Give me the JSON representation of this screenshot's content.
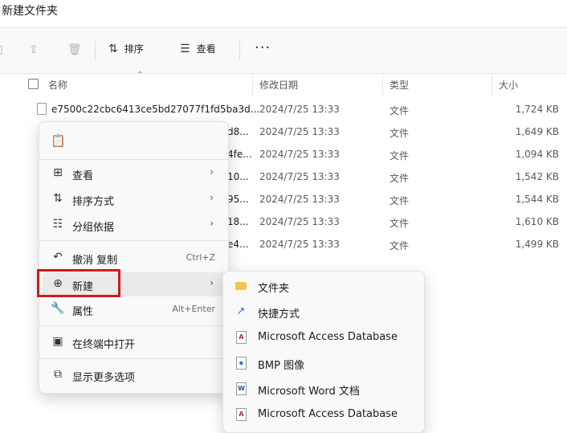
{
  "window": {
    "title": "新建文件夹"
  },
  "toolbar": {
    "sort_label": "排序",
    "view_label": "查看",
    "more_label": "···"
  },
  "columns": {
    "name": "名称",
    "modified": "修改日期",
    "type": "类型",
    "size": "大小"
  },
  "files": [
    {
      "name": "e7500c22cbc6413ce5bd27077f1fd5ba3d...",
      "date": "2024/7/25 13:33",
      "type": "文件",
      "size": "1,724 KB"
    },
    {
      "name": "d8...",
      "date": "2024/7/25 13:33",
      "type": "文件",
      "size": "1,649 KB"
    },
    {
      "name": "4fe...",
      "date": "2024/7/25 13:33",
      "type": "文件",
      "size": "1,094 KB"
    },
    {
      "name": "10...",
      "date": "2024/7/25 13:33",
      "type": "文件",
      "size": "1,542 KB"
    },
    {
      "name": "95...",
      "date": "2024/7/25 13:33",
      "type": "文件",
      "size": "1,544 KB"
    },
    {
      "name": "18...",
      "date": "2024/7/25 13:33",
      "type": "文件",
      "size": "1,610 KB"
    },
    {
      "name": "e4...",
      "date": "2024/7/25 13:33",
      "type": "文件",
      "size": "1,499 KB"
    }
  ],
  "context_menu": {
    "items": [
      {
        "label": "查看",
        "icon": "grid-icon"
      },
      {
        "label": "排序方式",
        "icon": "sort-icon"
      },
      {
        "label": "分组依据",
        "icon": "list-icon"
      },
      {
        "label": "撤消 复制",
        "shortcut": "Ctrl+Z",
        "icon": "undo-icon"
      },
      {
        "label": "新建",
        "icon": "add-circle-icon"
      },
      {
        "label": "属性",
        "shortcut": "Alt+Enter",
        "icon": "wrench-icon"
      },
      {
        "label": "在终端中打开",
        "icon": "terminal-icon"
      },
      {
        "label": "显示更多选项",
        "icon": "open-external-icon"
      }
    ]
  },
  "new_submenu": {
    "items": [
      {
        "label": "文件夹",
        "icon": "folder-icon"
      },
      {
        "label": "快捷方式",
        "icon": "shortcut-icon"
      },
      {
        "label": "Microsoft Access Database",
        "icon": "access-icon"
      },
      {
        "label": "BMP 图像",
        "icon": "bmp-icon"
      },
      {
        "label": "Microsoft Word 文档",
        "icon": "word-icon"
      },
      {
        "label": "Microsoft Access Database",
        "icon": "access-icon"
      }
    ]
  },
  "colors": {
    "highlight": "#d11a1a",
    "folder": "#f3c645",
    "access": "#a4373a",
    "word": "#2b579a",
    "shortcut": "#1a73e8"
  }
}
